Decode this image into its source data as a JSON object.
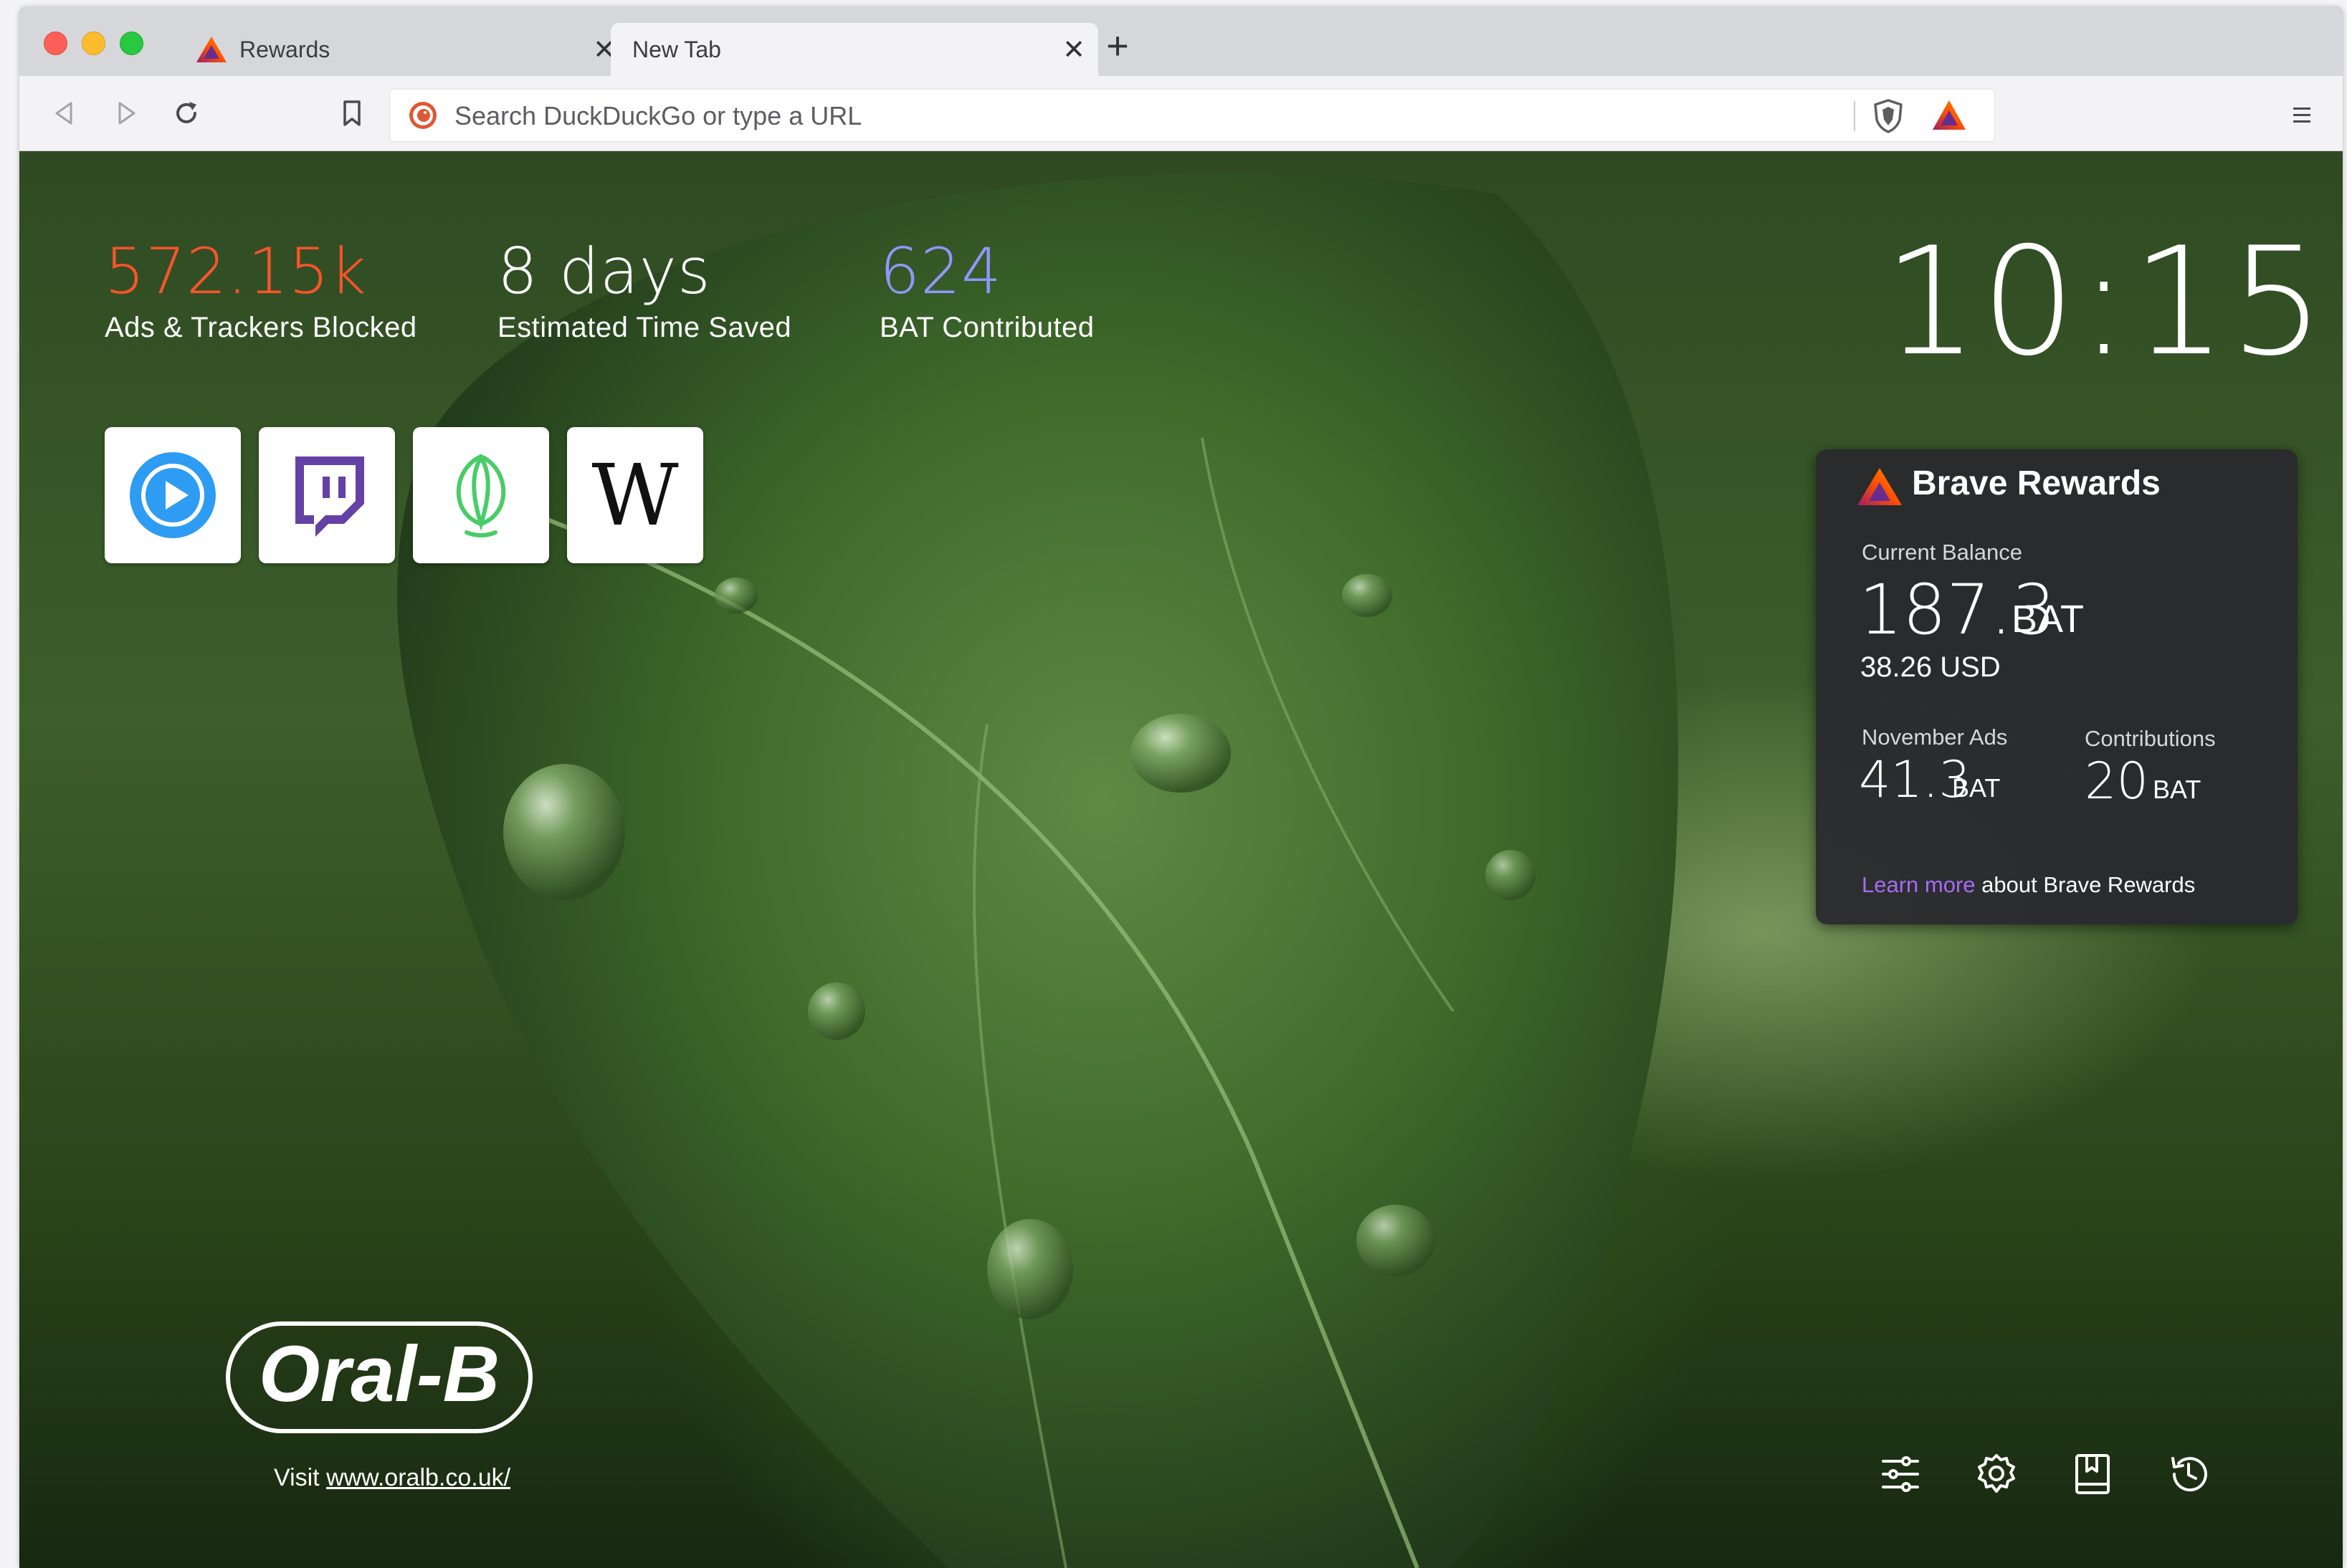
{
  "tabs": [
    {
      "title": "Rewards",
      "close": "✕"
    },
    {
      "title": "New Tab",
      "close": "✕"
    }
  ],
  "new_tab_label": "+",
  "toolbar": {
    "search_placeholder": "Search DuckDuckGo or type a URL"
  },
  "stats": [
    {
      "value": "572.15k",
      "label": "Ads & Trackers Blocked",
      "color": "#fb542b"
    },
    {
      "value": "8 days",
      "label": "Estimated Time Saved",
      "color": "#ffffff"
    },
    {
      "value": "624",
      "label": "BAT Contributed",
      "color": "#8f98ff"
    }
  ],
  "clock": "10:15",
  "top_sites": [
    {
      "icon": "play-button-icon"
    },
    {
      "icon": "twitch-icon"
    },
    {
      "icon": "uphold-icon"
    },
    {
      "icon": "wikipedia-icon",
      "text": "W"
    }
  ],
  "rewards": {
    "title": "Brave Rewards",
    "balance_label": "Current Balance",
    "balance_value": "187.3",
    "balance_unit": "BAT",
    "usd": "38.26 USD",
    "ads_label": "November Ads",
    "ads_value": "41.3",
    "ads_unit": "BAT",
    "contributions_label": "Contributions",
    "contributions_value": "20",
    "contributions_unit": "BAT",
    "learn_more_link": "Learn more",
    "learn_more_rest": " about Brave Rewards"
  },
  "sponsor": {
    "logo_text": "Oral-B",
    "visit_prefix": "Visit ",
    "visit_link": "www.oralb.co.uk/"
  },
  "bottom_icons": [
    "customize-icon",
    "settings-icon",
    "bookmarks-icon",
    "history-icon"
  ]
}
